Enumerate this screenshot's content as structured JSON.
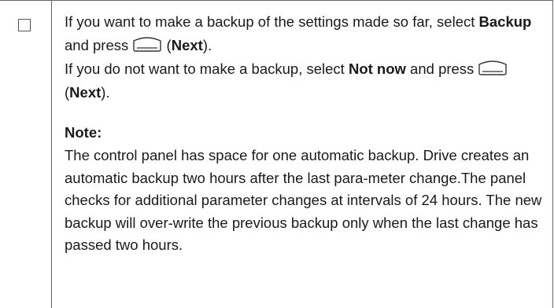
{
  "instructions": {
    "step1": {
      "text_a": "If you want to make a backup of the settings made so far, select ",
      "bold_a": "Backup",
      "text_b": " and press ",
      "key_icon": "softkey-button-icon",
      "text_c": " (",
      "bold_b": "Next",
      "text_d": ")."
    },
    "step2": {
      "text_a": "If you do not want to make a backup, select ",
      "bold_a": "Not now",
      "text_b": " and press ",
      "key_icon": "softkey-button-icon",
      "text_c": " (",
      "bold_b": "Next",
      "text_d": ")."
    }
  },
  "note": {
    "heading": "Note:",
    "body": "The control panel has space for one automatic backup. Drive creates an automatic backup two hours after the last para-meter change.The panel checks for additional parameter changes at intervals of 24 hours. The new backup will over-write the previous backup only when the last change has passed two hours."
  },
  "checkbox": {
    "checked": false
  }
}
